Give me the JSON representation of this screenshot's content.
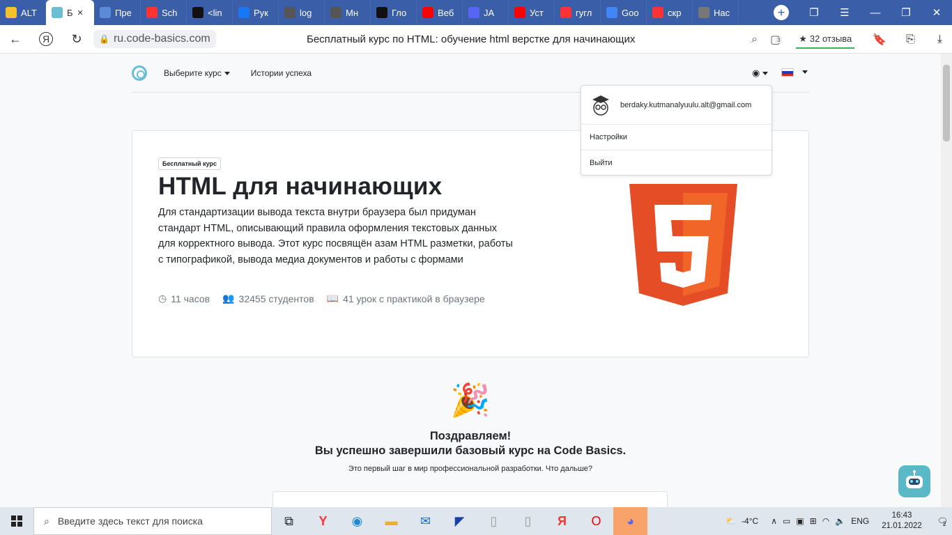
{
  "browser": {
    "tabs": [
      {
        "label": "ALT",
        "icon": "sparkle-icon",
        "color": "#f6c12b"
      },
      {
        "label": "Б",
        "icon": "code-basics-icon",
        "color": "#6bbdd1",
        "active": true
      },
      {
        "label": "Пре",
        "icon": "gallery-icon",
        "color": "#5b8bd6"
      },
      {
        "label": "Sch",
        "icon": "yandex-icon",
        "color": "#f33"
      },
      {
        "label": "<lin",
        "icon": "tiktok-icon",
        "color": "#111"
      },
      {
        "label": "Рук",
        "icon": "facebook-icon",
        "color": "#1877f2"
      },
      {
        "label": "log",
        "icon": "wordpress-icon",
        "color": "#555"
      },
      {
        "label": "Мн",
        "icon": "wikipedia-icon",
        "color": "#555"
      },
      {
        "label": "Гло",
        "icon": "tiktok-icon",
        "color": "#111"
      },
      {
        "label": "Веб",
        "icon": "youtube-icon",
        "color": "#f00"
      },
      {
        "label": "JA",
        "icon": "discord-icon",
        "color": "#5865f2"
      },
      {
        "label": "Уст",
        "icon": "youtube-icon",
        "color": "#f00"
      },
      {
        "label": "гугл",
        "icon": "yandex-icon",
        "color": "#f33"
      },
      {
        "label": "Goo",
        "icon": "translate-icon",
        "color": "#4285f4"
      },
      {
        "label": "скр",
        "icon": "yandex-icon",
        "color": "#f33"
      },
      {
        "label": "Нас",
        "icon": "gear-icon",
        "color": "#777"
      }
    ],
    "url": "ru.code-basics.com",
    "page_title": "Бесплатный курс по HTML: обучение html верстке для начинающих",
    "reviews": "32 отзыва",
    "downloads_badge": "3"
  },
  "site": {
    "nav_choose_course": "Выберите курс",
    "nav_success_stories": "Истории успеха"
  },
  "dropdown": {
    "email": "berdaky.kutmanalyuulu.alt@gmail.com",
    "settings": "Настройки",
    "logout": "Выйти"
  },
  "hero": {
    "badge": "Бесплатный курс",
    "title": "HTML для начинающих",
    "description": "Для стандартизации вывода текста внутри браузера был придуман стандарт HTML, описывающий правила оформления текстовых данных для корректного вывода. Этот курс посвящён азам HTML разметки, работы с типографикой, вывода медиа документов и работы с формами",
    "hours": "11 часов",
    "students": "32455 студентов",
    "lessons": "41 урок с практикой в браузере"
  },
  "congrats": {
    "emoji": "🎉",
    "title1": "Поздравляем!",
    "title2": "Вы успешно завершили базовый курс на Code Basics.",
    "subtitle": "Это первый шаг в мир профессиональной разработки. Что дальше?"
  },
  "taskbar": {
    "search_placeholder": "Введите здесь текст для поиска",
    "weather": "-4°C",
    "lang": "ENG",
    "time": "16:43",
    "date": "21.01.2022",
    "notifications": "2"
  },
  "colors": {
    "html5_orange": "#e44d26",
    "html5_light": "#f16529",
    "tab_bar": "#3a5fa8"
  }
}
